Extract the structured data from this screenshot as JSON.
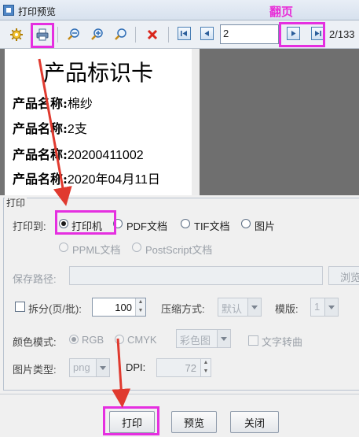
{
  "window": {
    "title": "打印预览"
  },
  "toolbar": {
    "page_input": "2",
    "page_count": "2/133",
    "icons": [
      "gear-icon",
      "printer-icon",
      "zoom-out-icon",
      "zoom-in-icon",
      "zoom-fit-icon",
      "close-x-icon",
      "first-page-icon",
      "prev-page-icon",
      "next-page-icon",
      "last-page-icon"
    ]
  },
  "annotation": {
    "label": "翻页",
    "color": "#e52fe0"
  },
  "preview": {
    "card_title": "产品标识卡",
    "lines": [
      {
        "key": "产品名称:",
        "value": "棉纱"
      },
      {
        "key": "产品名称:",
        "value": "2支"
      },
      {
        "key": "产品名称:",
        "value": "20200411002"
      },
      {
        "key": "产品名称:",
        "value": "2020年04月11日"
      }
    ]
  },
  "print_group": {
    "legend": "打印",
    "print_to_label": "打印到:",
    "targets": [
      "打印机",
      "PDF文档",
      "TIF文档",
      "图片",
      "PPML文档",
      "PostScript文档"
    ],
    "selected_target": "打印机",
    "save_path_label": "保存路径:",
    "save_path_value": "",
    "browse_label": "浏览",
    "split_label": "拆分(页/批):",
    "split_value": "100",
    "compress_label": "压缩方式:",
    "compress_value": "默认",
    "template_label": "模版:",
    "template_value": "1",
    "color_mode_label": "颜色模式:",
    "color_modes": [
      "RGB",
      "CMYK"
    ],
    "selected_color_mode": "RGB",
    "color_combo_value": "彩色图",
    "text_to_curve_label": "文字转曲",
    "image_type_label": "图片类型:",
    "image_type_value": "png",
    "dpi_label": "DPI:",
    "dpi_value": "72"
  },
  "footer": {
    "print_button": "打印",
    "preview_button": "预览",
    "close_button": "关闭"
  }
}
